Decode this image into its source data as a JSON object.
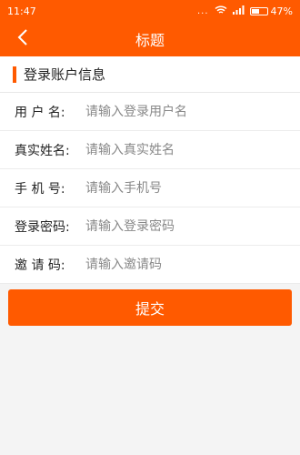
{
  "status_bar": {
    "time": "11:47",
    "dots": "...",
    "battery_percent": "47%",
    "battery_level": 0.47
  },
  "nav": {
    "title": "标题"
  },
  "section": {
    "title": "登录账户信息"
  },
  "form": {
    "fields": [
      {
        "label": "用 户 名:",
        "placeholder": "请输入登录用户名",
        "value": ""
      },
      {
        "label": "真实姓名:",
        "placeholder": "请输入真实姓名",
        "value": ""
      },
      {
        "label": "手 机 号:",
        "placeholder": "请输入手机号",
        "value": ""
      },
      {
        "label": "登录密码:",
        "placeholder": "请输入登录密码",
        "value": ""
      },
      {
        "label": "邀 请 码:",
        "placeholder": "请输入邀请码",
        "value": ""
      }
    ],
    "submit_label": "提交"
  },
  "colors": {
    "brand": "#ff5a00"
  }
}
